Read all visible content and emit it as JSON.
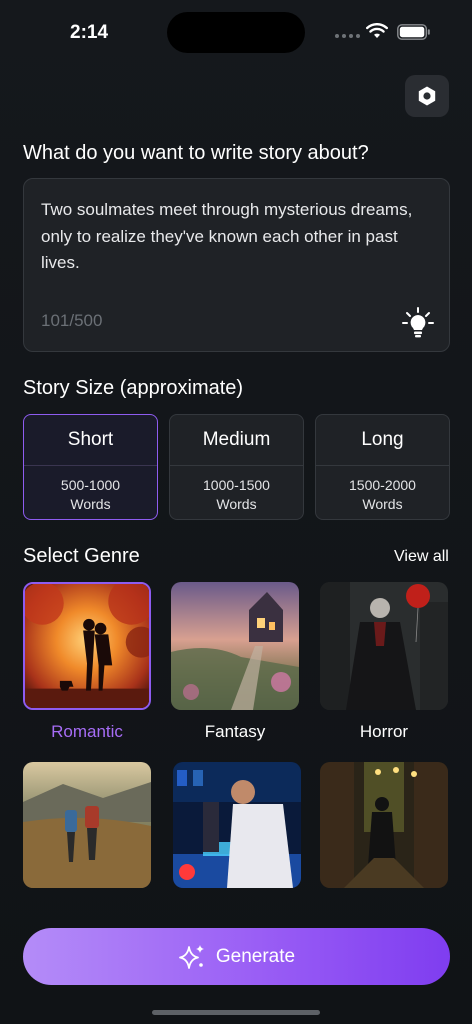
{
  "status_bar": {
    "time": "2:14"
  },
  "prompt": {
    "label": "What do you want to write story about?",
    "text": "Two soulmates meet through mysterious dreams, only to realize they've known each other in past lives.",
    "count": "101/500",
    "icon": "lightbulb-icon"
  },
  "size": {
    "label": "Story Size (approximate)",
    "options": [
      {
        "title": "Short",
        "range": "500-1000",
        "unit": "Words",
        "selected": true
      },
      {
        "title": "Medium",
        "range": "1000-1500",
        "unit": "Words",
        "selected": false
      },
      {
        "title": "Long",
        "range": "1500-2000",
        "unit": "Words",
        "selected": false
      }
    ]
  },
  "genre": {
    "label": "Select Genre",
    "view_all": "View all",
    "items": [
      {
        "name": "Romantic",
        "selected": true
      },
      {
        "name": "Fantasy",
        "selected": false
      },
      {
        "name": "Horror",
        "selected": false
      }
    ]
  },
  "generate": {
    "label": "Generate",
    "icon": "sparkles-icon"
  },
  "colors": {
    "accent": "#8e5cf0",
    "selected_text": "#a66cf5",
    "background": "#131619"
  }
}
